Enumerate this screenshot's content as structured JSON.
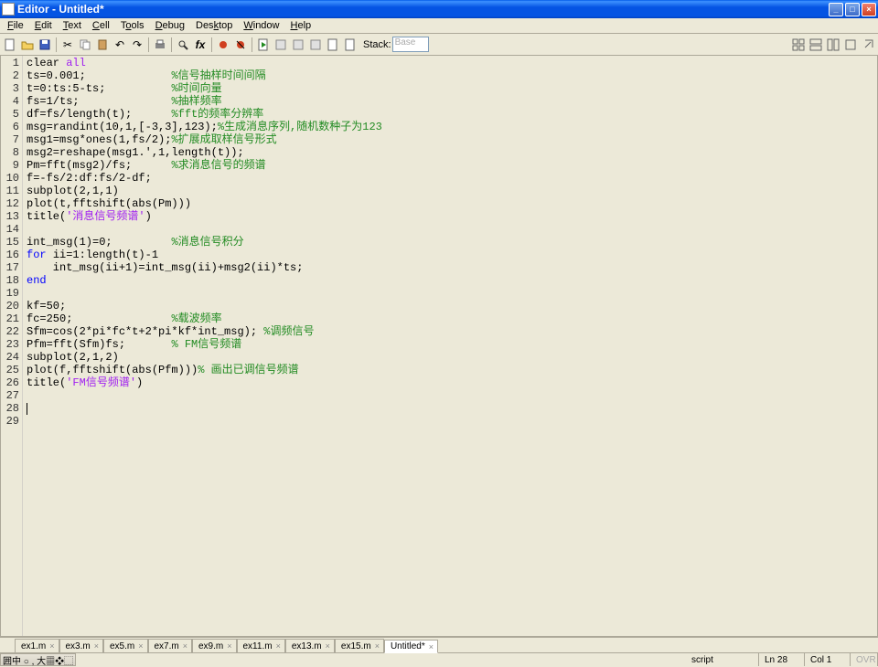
{
  "window": {
    "title": "Editor - Untitled*"
  },
  "menu": {
    "file": "File",
    "edit": "Edit",
    "text": "Text",
    "cell": "Cell",
    "tools": "Tools",
    "debug": "Debug",
    "desktop": "Desktop",
    "window": "Window",
    "help": "Help"
  },
  "toolbar": {
    "stack_label": "Stack:",
    "stack_value": "Base"
  },
  "code": {
    "lines": [
      {
        "n": 1,
        "seg": [
          {
            "t": "clear ",
            "c": ""
          },
          {
            "t": "all",
            "c": "str"
          }
        ]
      },
      {
        "n": 2,
        "seg": [
          {
            "t": "ts=0.001;",
            "c": ""
          },
          {
            "pad": 22
          },
          {
            "t": "%信号抽样时间间隔",
            "c": "cmt"
          }
        ]
      },
      {
        "n": 3,
        "seg": [
          {
            "t": "t=0:ts:5-ts;",
            "c": ""
          },
          {
            "pad": 22
          },
          {
            "t": "%时间向量",
            "c": "cmt"
          }
        ]
      },
      {
        "n": 4,
        "seg": [
          {
            "t": "fs=1/ts;",
            "c": ""
          },
          {
            "pad": 22
          },
          {
            "t": "%抽样频率",
            "c": "cmt"
          }
        ]
      },
      {
        "n": 5,
        "seg": [
          {
            "t": "df=fs/length(t);",
            "c": ""
          },
          {
            "pad": 22
          },
          {
            "t": "%fft的频率分辨率",
            "c": "cmt"
          }
        ]
      },
      {
        "n": 6,
        "seg": [
          {
            "t": "msg=randint(10,1,[-3,3],123);",
            "c": ""
          },
          {
            "pad": 22
          },
          {
            "t": "%生成消息序列,随机数种子为123",
            "c": "cmt"
          }
        ]
      },
      {
        "n": 7,
        "seg": [
          {
            "t": "msg1=msg*ones(1,fs/2);",
            "c": ""
          },
          {
            "pad": 22
          },
          {
            "t": "%扩展成取样信号形式",
            "c": "cmt"
          }
        ]
      },
      {
        "n": 8,
        "seg": [
          {
            "t": "msg2=reshape(msg1.',1,length(t));",
            "c": ""
          }
        ]
      },
      {
        "n": 9,
        "seg": [
          {
            "t": "Pm=fft(msg2)/fs;",
            "c": ""
          },
          {
            "pad": 22
          },
          {
            "t": "%求消息信号的频谱",
            "c": "cmt"
          }
        ]
      },
      {
        "n": 10,
        "seg": [
          {
            "t": "f=-fs/2:df:fs/2-df;",
            "c": ""
          }
        ]
      },
      {
        "n": 11,
        "seg": [
          {
            "t": "subplot(2,1,1)",
            "c": ""
          }
        ]
      },
      {
        "n": 12,
        "seg": [
          {
            "t": "plot(t,fftshift(abs(Pm)))",
            "c": ""
          }
        ]
      },
      {
        "n": 13,
        "seg": [
          {
            "t": "title(",
            "c": ""
          },
          {
            "t": "'消息信号频谱'",
            "c": "str"
          },
          {
            "t": ")",
            "c": ""
          }
        ]
      },
      {
        "n": 14,
        "seg": []
      },
      {
        "n": 15,
        "seg": [
          {
            "t": "int_msg(1)=0;",
            "c": ""
          },
          {
            "pad": 22
          },
          {
            "t": "%消息信号积分",
            "c": "cmt"
          }
        ]
      },
      {
        "n": 16,
        "seg": [
          {
            "t": "for ",
            "c": "kw"
          },
          {
            "t": "ii=1:length(t)-1",
            "c": ""
          }
        ]
      },
      {
        "n": 17,
        "seg": [
          {
            "t": "    int_msg(ii+1)=int_msg(ii)+msg2(ii)*ts;",
            "c": ""
          }
        ]
      },
      {
        "n": 18,
        "seg": [
          {
            "t": "end",
            "c": "kw"
          }
        ]
      },
      {
        "n": 19,
        "seg": []
      },
      {
        "n": 20,
        "seg": [
          {
            "t": "kf=50;",
            "c": ""
          }
        ]
      },
      {
        "n": 21,
        "seg": [
          {
            "t": "fc=250;",
            "c": ""
          },
          {
            "pad": 22
          },
          {
            "t": "%载波频率",
            "c": "cmt"
          }
        ]
      },
      {
        "n": 22,
        "seg": [
          {
            "t": "Sfm=cos(2*pi*fc*t+2*pi*kf*int_msg); ",
            "c": ""
          },
          {
            "t": "%调频信号",
            "c": "cmt"
          }
        ]
      },
      {
        "n": 23,
        "seg": [
          {
            "t": "Pfm=fft(Sfm)fs;",
            "c": ""
          },
          {
            "pad": 22
          },
          {
            "t": "% FM信号频谱",
            "c": "cmt"
          }
        ]
      },
      {
        "n": 24,
        "seg": [
          {
            "t": "subplot(2,1,2)",
            "c": ""
          }
        ]
      },
      {
        "n": 25,
        "seg": [
          {
            "t": "plot(f,fftshift(abs(Pfm)))",
            "c": ""
          },
          {
            "pad": 22
          },
          {
            "t": "% 画出已调信号频谱",
            "c": "cmt"
          }
        ]
      },
      {
        "n": 26,
        "seg": [
          {
            "t": "title(",
            "c": ""
          },
          {
            "t": "'FM信号频谱'",
            "c": "str"
          },
          {
            "t": ")",
            "c": ""
          }
        ]
      },
      {
        "n": 27,
        "seg": []
      },
      {
        "n": 28,
        "seg": [],
        "cursor": true
      },
      {
        "n": 29,
        "seg": []
      }
    ]
  },
  "tabs": [
    {
      "label": "ex1.m"
    },
    {
      "label": "ex3.m"
    },
    {
      "label": "ex5.m"
    },
    {
      "label": "ex7.m"
    },
    {
      "label": "ex9.m"
    },
    {
      "label": "ex11.m"
    },
    {
      "label": "ex13.m"
    },
    {
      "label": "ex15.m"
    },
    {
      "label": "Untitled*",
      "active": true
    }
  ],
  "status": {
    "type": "script",
    "ln": "Ln 28",
    "col": "Col 1",
    "ovr": "OVR"
  },
  "ime": {
    "text": "中 , 大"
  }
}
